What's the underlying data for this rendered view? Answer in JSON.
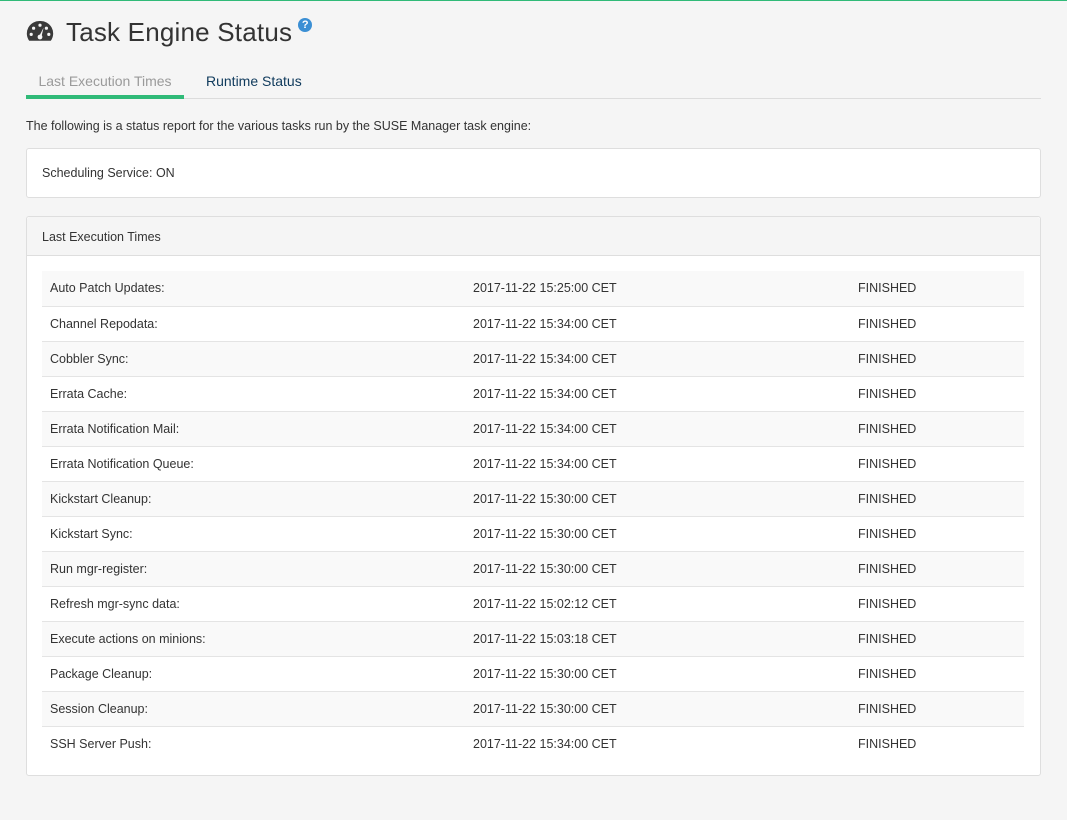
{
  "header": {
    "title": "Task Engine Status",
    "help_glyph": "?"
  },
  "tabs": [
    {
      "label": "Last Execution Times",
      "active": true
    },
    {
      "label": "Runtime Status",
      "active": false
    }
  ],
  "intro": "The following is a status report for the various tasks run by the SUSE Manager task engine:",
  "scheduling_service": "Scheduling Service: ON",
  "executions": {
    "heading": "Last Execution Times",
    "rows": [
      {
        "task": "Auto Patch Updates:",
        "time": "2017-11-22 15:25:00 CET",
        "status": "FINISHED"
      },
      {
        "task": "Channel Repodata:",
        "time": "2017-11-22 15:34:00 CET",
        "status": "FINISHED"
      },
      {
        "task": "Cobbler Sync:",
        "time": "2017-11-22 15:34:00 CET",
        "status": "FINISHED"
      },
      {
        "task": "Errata Cache:",
        "time": "2017-11-22 15:34:00 CET",
        "status": "FINISHED"
      },
      {
        "task": "Errata Notification Mail:",
        "time": "2017-11-22 15:34:00 CET",
        "status": "FINISHED"
      },
      {
        "task": "Errata Notification Queue:",
        "time": "2017-11-22 15:34:00 CET",
        "status": "FINISHED"
      },
      {
        "task": "Kickstart Cleanup:",
        "time": "2017-11-22 15:30:00 CET",
        "status": "FINISHED"
      },
      {
        "task": "Kickstart Sync:",
        "time": "2017-11-22 15:30:00 CET",
        "status": "FINISHED"
      },
      {
        "task": "Run mgr-register:",
        "time": "2017-11-22 15:30:00 CET",
        "status": "FINISHED"
      },
      {
        "task": "Refresh mgr-sync data:",
        "time": "2017-11-22 15:02:12 CET",
        "status": "FINISHED"
      },
      {
        "task": "Execute actions on minions:",
        "time": "2017-11-22 15:03:18 CET",
        "status": "FINISHED"
      },
      {
        "task": "Package Cleanup:",
        "time": "2017-11-22 15:30:00 CET",
        "status": "FINISHED"
      },
      {
        "task": "Session Cleanup:",
        "time": "2017-11-22 15:30:00 CET",
        "status": "FINISHED"
      },
      {
        "task": "SSH Server Push:",
        "time": "2017-11-22 15:34:00 CET",
        "status": "FINISHED"
      }
    ]
  },
  "colors": {
    "accent": "#30ba78",
    "tab_link": "#0f3a5c",
    "help_icon": "#3b8fd4"
  },
  "icons": {
    "page_icon": "tachometer-icon",
    "help_icon": "question-circle-icon"
  }
}
